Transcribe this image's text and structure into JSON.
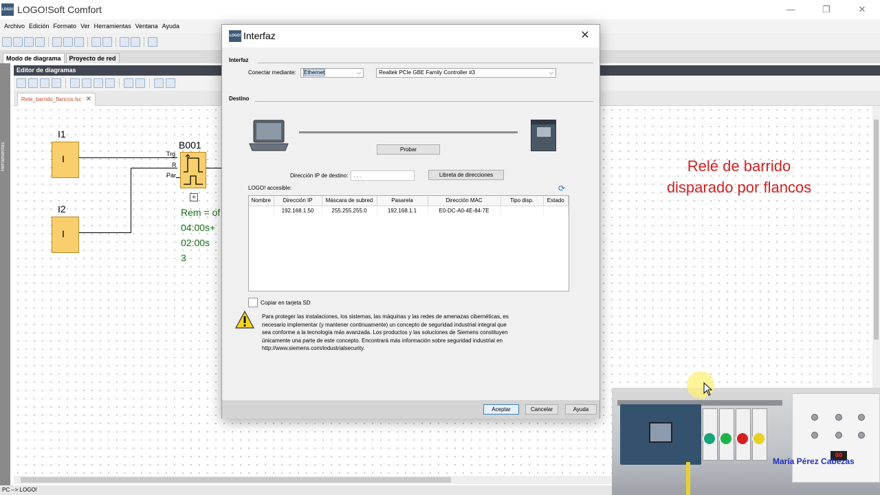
{
  "app": {
    "title": "LOGO!Soft Comfort",
    "logo_text": "LOGO!",
    "minimize": "—",
    "restore": "❐",
    "close": "✕"
  },
  "menu": [
    "Archivo",
    "Edición",
    "Formato",
    "Ver",
    "Herramientas",
    "Ventana",
    "Ayuda"
  ],
  "mode_tabs": [
    "Modo de diagrama",
    "Proyecto de red"
  ],
  "sidebar": {
    "label": "Herramientas"
  },
  "editor": {
    "header": "Editor de diagramas",
    "doc_tab": "Rele_barrido_flancos.lsc",
    "doc_tab_close": "✕"
  },
  "diagram": {
    "inputs": [
      {
        "name": "I1",
        "symbol": "I"
      },
      {
        "name": "I2",
        "symbol": "I"
      }
    ],
    "block": {
      "name": "B001",
      "pins": [
        "Trg",
        "R",
        "Par"
      ],
      "expand": "+"
    },
    "params": [
      "Rem = of",
      "04:00s+",
      "02:00s",
      "3"
    ]
  },
  "annotation": {
    "line1": "Relé de barrido",
    "line2": "disparado por flancos"
  },
  "status_bar": "PC --> LOGO!",
  "webcam": {
    "presenter": "María Pérez Cabezas",
    "display": "00"
  },
  "dialog": {
    "title": "Interfaz",
    "close": "✕",
    "interface_section": "Interfaz",
    "connect_label": "Conectar mediante:",
    "connect_value": "Ethernet",
    "adapter_value": "Realtek PCIe GBE Family Controller #3",
    "dest_section": "Destino",
    "test_button": "Probar",
    "dest_ip_label": "Dirección IP de destino:",
    "dest_ip_value": ". . .",
    "address_book_button": "Libreta de direcciones",
    "accessible_label": "LOGO! accesible:",
    "table": {
      "headers": [
        "Nombre",
        "Dirección IP",
        "Máscara de subred",
        "Pasarela",
        "Dirección MAC",
        "Tipo disp.",
        "Estado"
      ],
      "rows": [
        [
          "",
          "192.168.1.50",
          "255.255.255.0",
          "192.168.1.1",
          "E0-DC-A0-4E-84-7E",
          "",
          ""
        ]
      ]
    },
    "sd_checkbox_label": "Copiar en tarjeta SD",
    "warning_text": "Para proteger las instalaciones, los sistemas, las máquinas y las redes de amenazas cibernéticas, es necesario implementar (y mantener continuamente) un concepto de seguridad industrial integral que sea conforme a la tecnología más avanzada. Los productos y las soluciones de Siemens constituyen únicamente una parte de este concepto. Encontrará más información sobre seguridad industrial en http://www.siemens.com/industrialsecurity.",
    "buttons": {
      "accept": "Aceptar",
      "cancel": "Cancelar",
      "help": "Ayuda"
    }
  },
  "colors": {
    "block_fill": "#f8cf6c",
    "param_text": "#1a6e1a",
    "annotation": "#d42020",
    "editor_header": "#414651"
  }
}
